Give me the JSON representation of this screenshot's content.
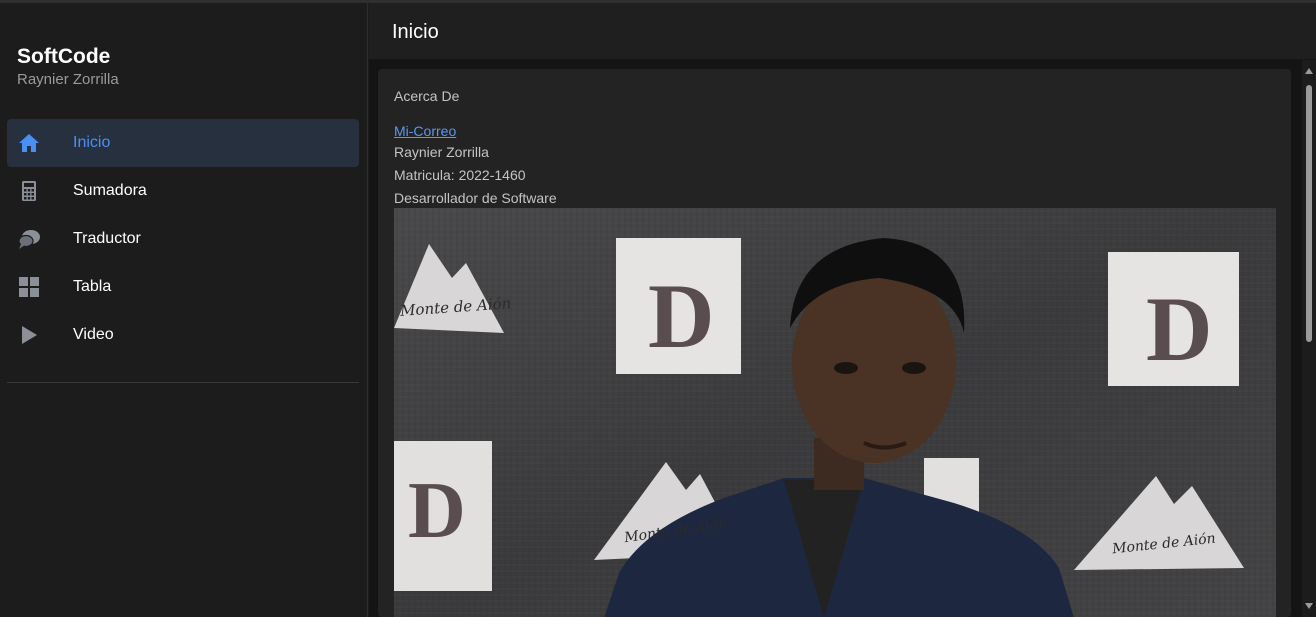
{
  "app": {
    "title": "SoftCode",
    "subtitle": "Raynier Zorrilla"
  },
  "sidebar": {
    "items": [
      {
        "label": "Inicio",
        "icon": "home-icon",
        "active": true
      },
      {
        "label": "Sumadora",
        "icon": "calculator-icon",
        "active": false
      },
      {
        "label": "Traductor",
        "icon": "chat-bubbles-icon",
        "active": false
      },
      {
        "label": "Tabla",
        "icon": "grid-icon",
        "active": false
      },
      {
        "label": "Video",
        "icon": "play-icon",
        "active": false
      }
    ]
  },
  "header": {
    "title": "Inicio"
  },
  "content": {
    "section_title": "Acerca De",
    "email_link": "Mi-Correo",
    "name": "Raynier Zorrilla",
    "matricula": "Matricula: 2022-1460",
    "role": "Desarrollador de Software",
    "photo": {
      "banner_letter": "D",
      "banner_logo_text": "Monte de Aión"
    }
  },
  "colors": {
    "accent": "#4b8ff5",
    "active_bg": "#26303f",
    "background": "#1c1c1c",
    "card": "#232323",
    "link": "#5b97ee"
  }
}
